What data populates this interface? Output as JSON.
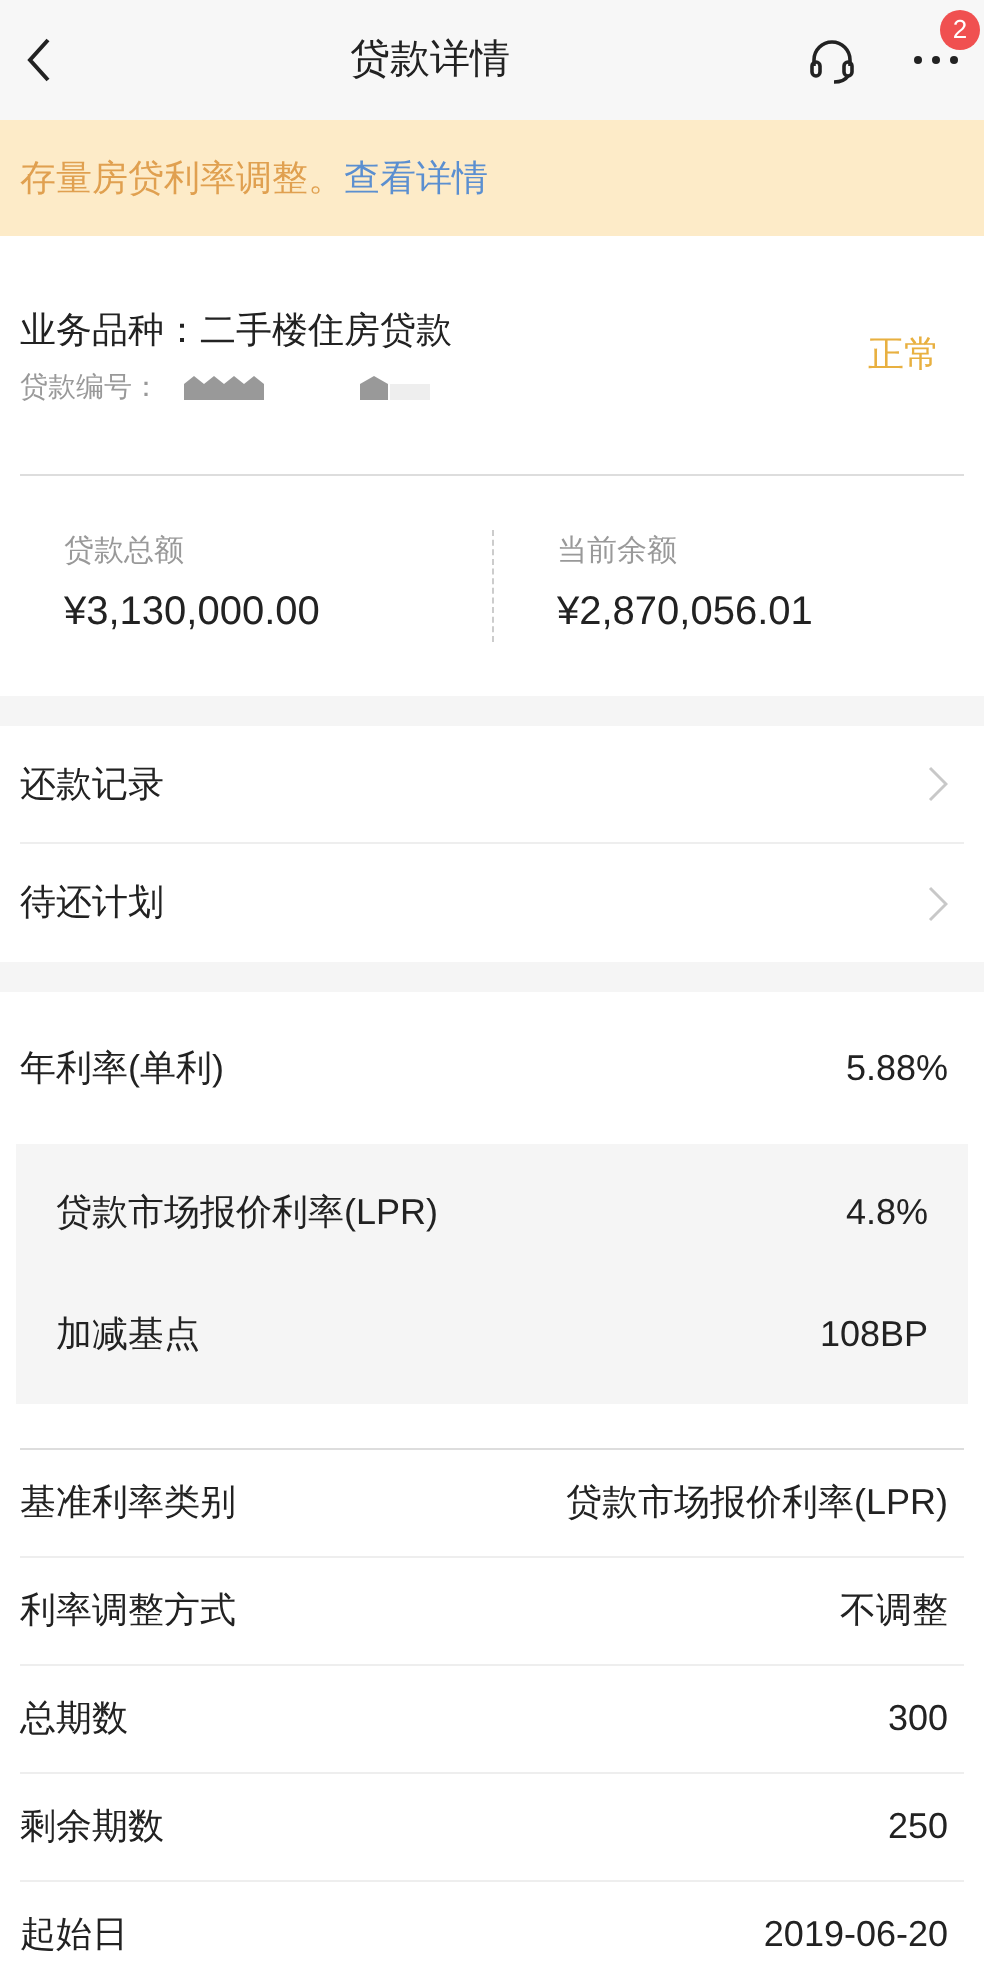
{
  "header": {
    "title": "贷款详情",
    "badge": "2"
  },
  "banner": {
    "text": "存量房贷利率调整。",
    "link": "查看详情"
  },
  "loan": {
    "product": "业务品种：二手楼住房贷款",
    "number_label": "贷款编号：",
    "status": "正常"
  },
  "amounts": [
    {
      "label": "贷款总额",
      "value": "¥3,130,000.00"
    },
    {
      "label": "当前余额",
      "value": "¥2,870,056.01"
    }
  ],
  "menu": [
    {
      "label": "还款记录"
    },
    {
      "label": "待还计划"
    }
  ],
  "rate": {
    "label": "年利率(单利)",
    "value": "5.88%",
    "components": [
      {
        "label": "贷款市场报价利率(LPR)",
        "value": "4.8%"
      },
      {
        "label": "加减基点",
        "value": "108BP"
      }
    ]
  },
  "details": [
    {
      "label": "基准利率类别",
      "value": "贷款市场报价利率(LPR)"
    },
    {
      "label": "利率调整方式",
      "value": "不调整"
    },
    {
      "label": "总期数",
      "value": "300"
    },
    {
      "label": "剩余期数",
      "value": "250"
    },
    {
      "label": "起始日",
      "value": "2019-06-20"
    }
  ]
}
